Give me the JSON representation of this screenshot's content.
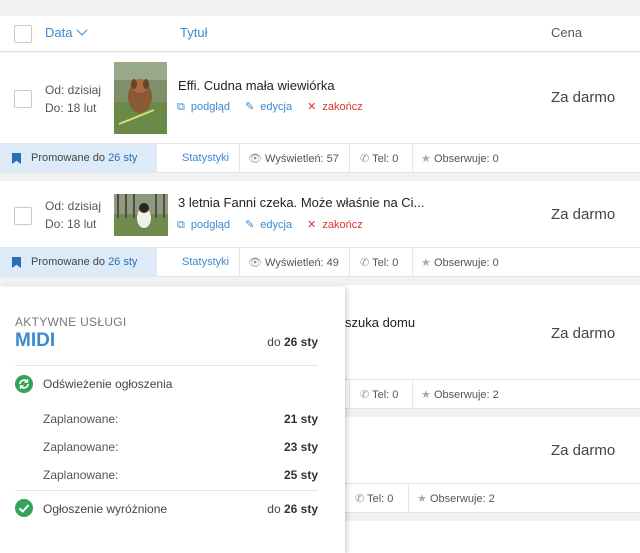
{
  "header": {
    "data_label": "Data",
    "title_label": "Tytuł",
    "price_label": "Cena"
  },
  "ads": [
    {
      "date_from": "Od: dzisiaj",
      "date_to": "Do: 18 lut",
      "title": "Effi. Cudna mała wiewiórka",
      "links": {
        "preview": "podgląd",
        "edit": "edycja",
        "end": "zakończ"
      },
      "price": "Za darmo",
      "stats": {
        "promo_prefix": "Promowane do",
        "promo_date": "26 sty",
        "stats_link": "Statystyki",
        "views": "Wyświetleń: 57",
        "phone": "Tel: 0",
        "watch": "Obserwuje: 0"
      }
    },
    {
      "date_from": "Od: dzisiaj",
      "date_to": "Do: 18 lut",
      "title": "3 letnia Fanni czeka. Może właśnie na Ci...",
      "links": {
        "preview": "podgląd",
        "edit": "edycja",
        "end": "zakończ"
      },
      "price": "Za darmo",
      "stats": {
        "promo_prefix": "Promowane do",
        "promo_date": "26 sty",
        "stats_link": "Statystyki",
        "views": "Wyświetleń: 49",
        "phone": "Tel: 0",
        "watch": "Obserwuje: 0"
      }
    },
    {
      "title_fragment": "szuka domu",
      "price": "Za darmo",
      "stats": {
        "phone": "Tel: 0",
        "watch": "Obserwuje: 2"
      }
    },
    {
      "price": "Za darmo",
      "stats": {
        "phone": "Tel: 0",
        "watch": "Obserwuje: 2"
      }
    }
  ],
  "popup": {
    "section_label": "AKTYWNE USŁUGI",
    "plan_name": "MIDI",
    "plan_until_prefix": "do",
    "plan_until_date": "26 sty",
    "refresh_service": "Odświeżenie ogłoszenia",
    "scheduled": [
      {
        "label": "Zaplanowane:",
        "date": "21 sty"
      },
      {
        "label": "Zaplanowane:",
        "date": "23 sty"
      },
      {
        "label": "Zaplanowane:",
        "date": "25 sty"
      }
    ],
    "highlight_service": "Ogłoszenie wyróżnione",
    "highlight_until_prefix": "do",
    "highlight_until_date": "26 sty"
  },
  "colors": {
    "accent": "#3b8ad0",
    "promo_bg": "#dcebf7",
    "success": "#35a35a",
    "danger": "#dd3333"
  }
}
